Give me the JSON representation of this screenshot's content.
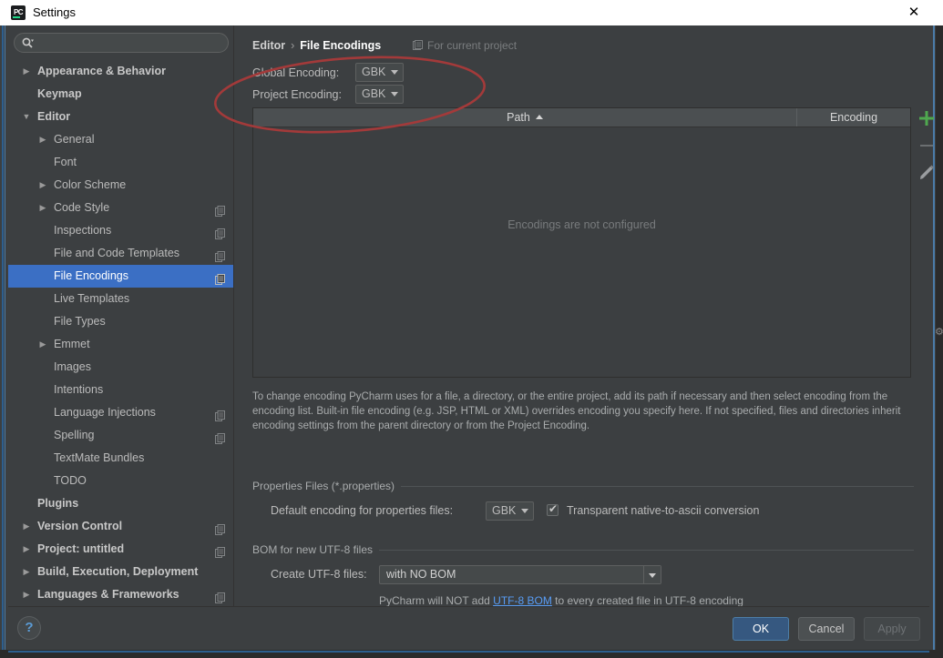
{
  "window": {
    "title": "Settings",
    "app_icon": "pycharm-icon",
    "close_icon": "close-icon"
  },
  "sidebar": {
    "search": {
      "value": "",
      "placeholder": "",
      "icon": "search-icon"
    },
    "items": [
      {
        "label": "Appearance & Behavior",
        "depth": 0,
        "arrow": "collapsed",
        "bold": true,
        "scope_icon": false,
        "selected": false
      },
      {
        "label": "Keymap",
        "depth": 0,
        "arrow": "none",
        "bold": true,
        "scope_icon": false,
        "selected": false
      },
      {
        "label": "Editor",
        "depth": 0,
        "arrow": "expanded",
        "bold": true,
        "scope_icon": false,
        "selected": false
      },
      {
        "label": "General",
        "depth": 1,
        "arrow": "collapsed",
        "bold": false,
        "scope_icon": false,
        "selected": false
      },
      {
        "label": "Font",
        "depth": 1,
        "arrow": "none",
        "bold": false,
        "scope_icon": false,
        "selected": false
      },
      {
        "label": "Color Scheme",
        "depth": 1,
        "arrow": "collapsed",
        "bold": false,
        "scope_icon": false,
        "selected": false
      },
      {
        "label": "Code Style",
        "depth": 1,
        "arrow": "collapsed",
        "bold": false,
        "scope_icon": true,
        "selected": false
      },
      {
        "label": "Inspections",
        "depth": 1,
        "arrow": "none",
        "bold": false,
        "scope_icon": true,
        "selected": false
      },
      {
        "label": "File and Code Templates",
        "depth": 1,
        "arrow": "none",
        "bold": false,
        "scope_icon": true,
        "selected": false
      },
      {
        "label": "File Encodings",
        "depth": 1,
        "arrow": "none",
        "bold": false,
        "scope_icon": true,
        "selected": true
      },
      {
        "label": "Live Templates",
        "depth": 1,
        "arrow": "none",
        "bold": false,
        "scope_icon": false,
        "selected": false
      },
      {
        "label": "File Types",
        "depth": 1,
        "arrow": "none",
        "bold": false,
        "scope_icon": false,
        "selected": false
      },
      {
        "label": "Emmet",
        "depth": 1,
        "arrow": "collapsed",
        "bold": false,
        "scope_icon": false,
        "selected": false
      },
      {
        "label": "Images",
        "depth": 1,
        "arrow": "none",
        "bold": false,
        "scope_icon": false,
        "selected": false
      },
      {
        "label": "Intentions",
        "depth": 1,
        "arrow": "none",
        "bold": false,
        "scope_icon": false,
        "selected": false
      },
      {
        "label": "Language Injections",
        "depth": 1,
        "arrow": "none",
        "bold": false,
        "scope_icon": true,
        "selected": false
      },
      {
        "label": "Spelling",
        "depth": 1,
        "arrow": "none",
        "bold": false,
        "scope_icon": true,
        "selected": false
      },
      {
        "label": "TextMate Bundles",
        "depth": 1,
        "arrow": "none",
        "bold": false,
        "scope_icon": false,
        "selected": false
      },
      {
        "label": "TODO",
        "depth": 1,
        "arrow": "none",
        "bold": false,
        "scope_icon": false,
        "selected": false
      },
      {
        "label": "Plugins",
        "depth": 0,
        "arrow": "none",
        "bold": true,
        "scope_icon": false,
        "selected": false
      },
      {
        "label": "Version Control",
        "depth": 0,
        "arrow": "collapsed",
        "bold": true,
        "scope_icon": true,
        "selected": false
      },
      {
        "label": "Project: untitled",
        "depth": 0,
        "arrow": "collapsed",
        "bold": true,
        "scope_icon": true,
        "selected": false
      },
      {
        "label": "Build, Execution, Deployment",
        "depth": 0,
        "arrow": "collapsed",
        "bold": true,
        "scope_icon": false,
        "selected": false
      },
      {
        "label": "Languages & Frameworks",
        "depth": 0,
        "arrow": "collapsed",
        "bold": true,
        "scope_icon": true,
        "selected": false
      }
    ]
  },
  "content": {
    "breadcrumb": {
      "parent": "Editor",
      "separator": "›",
      "current": "File Encodings"
    },
    "for_current_project": {
      "label": "For current project",
      "icon": "project-scope-icon"
    },
    "global_encoding": {
      "label": "Global Encoding:",
      "value": "GBK"
    },
    "project_encoding": {
      "label": "Project Encoding:",
      "value": "GBK"
    },
    "table": {
      "columns": [
        "Path",
        "Encoding"
      ],
      "sort_column": "Path",
      "sort_direction": "ascending",
      "rows": [],
      "empty_message": "Encodings are not configured"
    },
    "table_tools": [
      {
        "name": "add-button",
        "icon": "plus-icon",
        "enabled": true
      },
      {
        "name": "remove-button",
        "icon": "minus-icon",
        "enabled": false
      },
      {
        "name": "edit-button",
        "icon": "pencil-icon",
        "enabled": true
      }
    ],
    "description": "To change encoding PyCharm uses for a file, a directory, or the entire project, add its path if necessary and then select encoding from the encoding list. Built-in file encoding (e.g. JSP, HTML or XML) overrides encoding you specify here. If not specified, files and directories inherit encoding settings from the parent directory or from the Project Encoding.",
    "properties_group": {
      "title": "Properties Files (*.properties)",
      "default_encoding_label": "Default encoding for properties files:",
      "default_encoding_value": "GBK",
      "transparent_checkbox": {
        "label": "Transparent native-to-ascii conversion",
        "checked": true,
        "mark": "✔"
      }
    },
    "bom_group": {
      "title": "BOM for new UTF-8 files",
      "create_label": "Create UTF-8 files:",
      "create_value": "with NO BOM",
      "note_before": "PyCharm will NOT add ",
      "note_link": "UTF-8 BOM",
      "note_after": " to every created file in UTF-8 encoding"
    }
  },
  "footer": {
    "help": "?",
    "ok": "OK",
    "cancel": "Cancel",
    "apply": "Apply"
  },
  "annotation": {
    "shape": "ellipse",
    "color": "#a33a3a",
    "target": "global-and-project-encoding-rows"
  },
  "colors": {
    "panel_bg": "#3c3f41",
    "selection_blue": "#3b6fc4",
    "ok_button_blue": "#365880",
    "link_blue": "#589df6",
    "annotation_red": "#a33a3a",
    "titlebar_bg": "#ffffff"
  }
}
